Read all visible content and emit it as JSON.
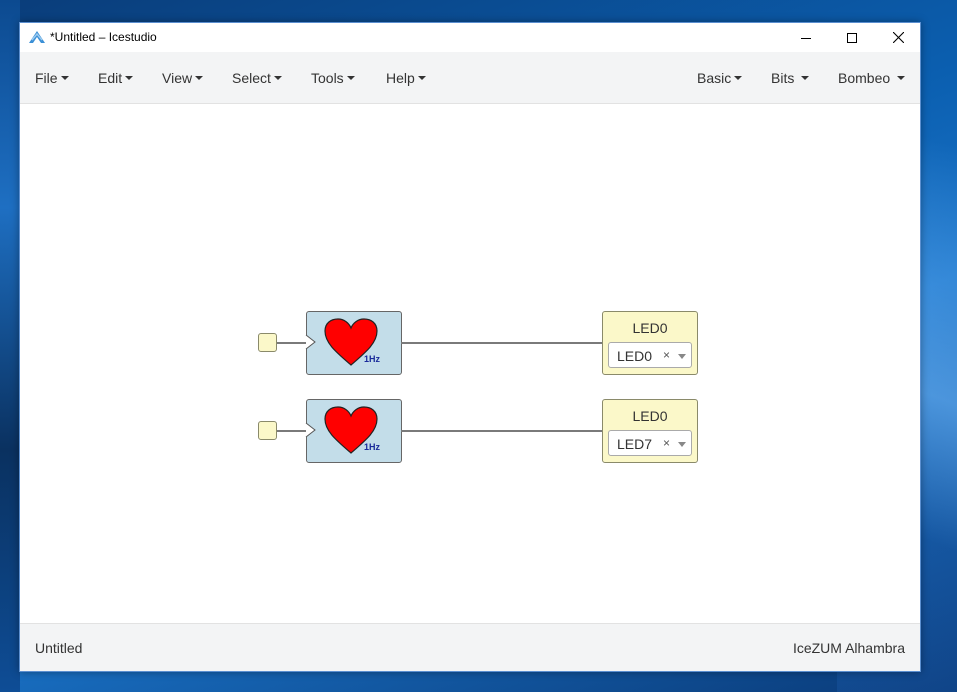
{
  "window": {
    "title": "*Untitled – Icestudio"
  },
  "menubar": {
    "left": [
      "File",
      "Edit",
      "View",
      "Select",
      "Tools",
      "Help"
    ],
    "right": [
      "Basic",
      "Bits",
      "Bombeo"
    ]
  },
  "canvas": {
    "rows": [
      {
        "clock_label": "1Hz",
        "led_name": "LED0",
        "led_pin": "LED0",
        "clear": "×"
      },
      {
        "clock_label": "1Hz",
        "led_name": "LED0",
        "led_pin": "LED7",
        "clear": "×"
      }
    ]
  },
  "status": {
    "project": "Untitled",
    "board": "IceZUM Alhambra"
  },
  "colors": {
    "heart": "#ff0000",
    "clock_block": "#c3dde9",
    "io_block": "#fbf8c9",
    "wire": "#7a7a7a"
  },
  "icons": {
    "app": "icestudio-logo-icon",
    "minimize": "minimize-icon",
    "maximize": "maximize-icon",
    "close": "close-icon",
    "heart": "heart-icon"
  }
}
